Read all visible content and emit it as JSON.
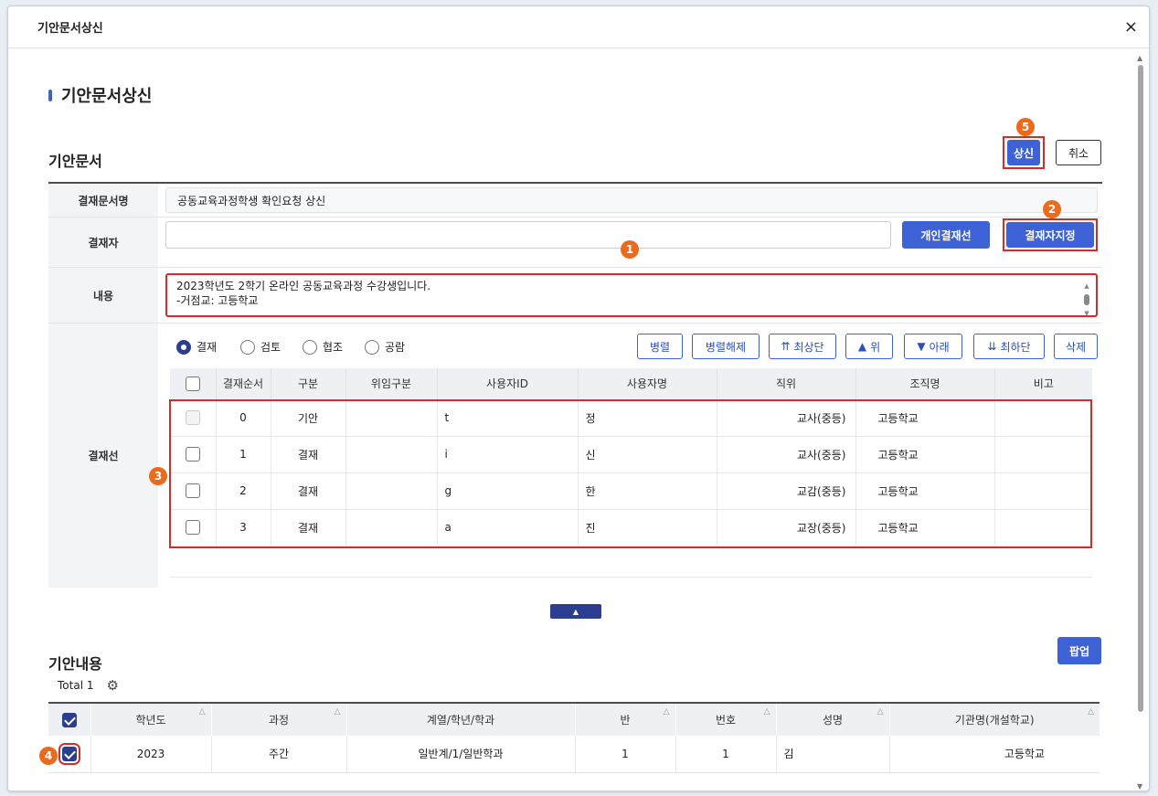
{
  "dialog": {
    "title": "기안문서상신",
    "close": "×"
  },
  "page_title": "기안문서상신",
  "section1": {
    "title": "기안문서"
  },
  "buttons": {
    "submit": "상신",
    "cancel": "취소",
    "personal_line": "개인결재선",
    "assign_approver": "결재자지정",
    "popup": "팝업"
  },
  "form": {
    "doc_name_label": "결재문서명",
    "doc_name_value": "공동교육과정학생 확인요청 상신",
    "approver_label": "결재자",
    "approver_value": "",
    "content_label": "내용",
    "content_line1": "2023학년도 2학기 온라인 공동교육과정 수강생입니다.",
    "content_line2": "-거점교:       고등학교",
    "line_label": "결재선"
  },
  "radios": [
    "결재",
    "검토",
    "협조",
    "공람"
  ],
  "radio_selected": "결재",
  "line_buttons": [
    "병렬",
    "병렬해제",
    "최상단",
    "위",
    "아래",
    "최하단",
    "삭제"
  ],
  "approval_table": {
    "headers": [
      "결재순서",
      "구분",
      "위임구분",
      "사용자ID",
      "사용자명",
      "직위",
      "조직명",
      "비고"
    ],
    "rows": [
      {
        "order": "0",
        "type": "기안",
        "delegate": "",
        "uid": "t",
        "name": "정",
        "position": "교사(중등)",
        "org": "고등학교",
        "note": ""
      },
      {
        "order": "1",
        "type": "결재",
        "delegate": "",
        "uid": "i",
        "name": "신",
        "position": "교사(중등)",
        "org": "고등학교",
        "note": ""
      },
      {
        "order": "2",
        "type": "결재",
        "delegate": "",
        "uid": "g",
        "name": "한",
        "position": "교감(중등)",
        "org": "고등학교",
        "note": ""
      },
      {
        "order": "3",
        "type": "결재",
        "delegate": "",
        "uid": "a",
        "name": "진",
        "position": "교장(중등)",
        "org": "고등학교",
        "note": ""
      }
    ]
  },
  "section2": {
    "title": "기안내용",
    "total": "Total 1"
  },
  "draft_table": {
    "headers": [
      "학년도",
      "과정",
      "계열/학년/학과",
      "반",
      "번호",
      "성명",
      "기관명(개설학교)"
    ],
    "rows": [
      {
        "year": "2023",
        "course": "주간",
        "dept": "일반계/1/일반학과",
        "class": "1",
        "number": "1",
        "name": "김",
        "school": "고등학교"
      }
    ]
  },
  "badges": [
    "1",
    "2",
    "3",
    "4",
    "5"
  ],
  "icons": {
    "settings": "gear-icon",
    "close": "close-icon",
    "collapse": "caret-up-icon"
  },
  "colors": {
    "primary": "#3d62d6",
    "highlight": "#d42b2b",
    "badge": "#ec6a1c"
  }
}
